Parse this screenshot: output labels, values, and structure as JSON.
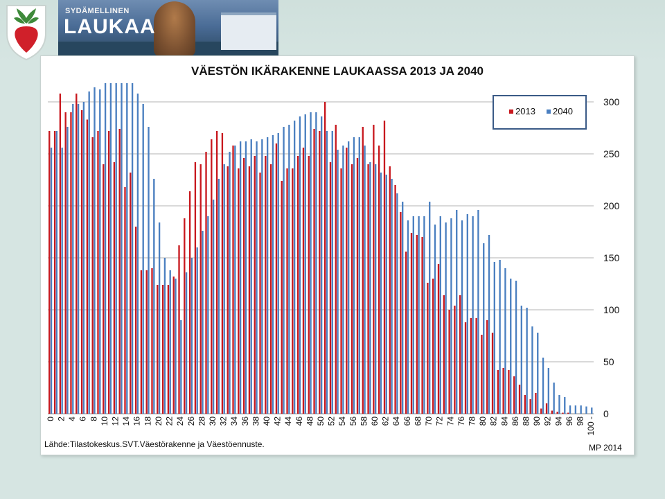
{
  "header": {
    "banner_small": "SYDÄMELLINEN",
    "banner_big": "LAUKAA"
  },
  "source": "Lähde:Tilastokeskus.SVT.Väestörakenne ja Väestöennuste.",
  "credit": "MP 2014",
  "colors": {
    "series_2013": "#c8181e",
    "series_2040": "#4a7fc0",
    "border": "#3a5a86",
    "gridline": "#b3b3b3"
  },
  "chart_data": {
    "type": "bar",
    "title": "VÄESTÖN IKÄRAKENNE LAUKAASSA 2013 JA 2040",
    "ylim": [
      0,
      320
    ],
    "yticks": [
      0,
      50,
      100,
      150,
      200,
      250,
      300
    ],
    "y_axis_side": "right",
    "grid": true,
    "legend_position": "top-right",
    "x_tick_labels": [
      "0",
      "2",
      "4",
      "6",
      "8",
      "10",
      "12",
      "14",
      "16",
      "18",
      "20",
      "22",
      "24",
      "26",
      "28",
      "30",
      "32",
      "34",
      "36",
      "38",
      "40",
      "42",
      "44",
      "46",
      "48",
      "50",
      "52",
      "54",
      "56",
      "58",
      "60",
      "62",
      "64",
      "66",
      "68",
      "70",
      "72",
      "74",
      "76",
      "78",
      "80",
      "82",
      "84",
      "86",
      "88",
      "90",
      "92",
      "94",
      "96",
      "98",
      "100 -"
    ],
    "categories": [
      "0",
      "1",
      "2",
      "3",
      "4",
      "5",
      "6",
      "7",
      "8",
      "9",
      "10",
      "11",
      "12",
      "13",
      "14",
      "15",
      "16",
      "17",
      "18",
      "19",
      "20",
      "21",
      "22",
      "23",
      "24",
      "25",
      "26",
      "27",
      "28",
      "29",
      "30",
      "31",
      "32",
      "33",
      "34",
      "35",
      "36",
      "37",
      "38",
      "39",
      "40",
      "41",
      "42",
      "43",
      "44",
      "45",
      "46",
      "47",
      "48",
      "49",
      "50",
      "51",
      "52",
      "53",
      "54",
      "55",
      "56",
      "57",
      "58",
      "59",
      "60",
      "61",
      "62",
      "63",
      "64",
      "65",
      "66",
      "67",
      "68",
      "69",
      "70",
      "71",
      "72",
      "73",
      "74",
      "75",
      "76",
      "77",
      "78",
      "79",
      "80",
      "81",
      "82",
      "83",
      "84",
      "85",
      "86",
      "87",
      "88",
      "89",
      "90",
      "91",
      "92",
      "93",
      "94",
      "95",
      "96",
      "97",
      "98",
      "99",
      "100 -"
    ],
    "series": [
      {
        "name": "2013",
        "values": [
          272,
          272,
          308,
          290,
          290,
          308,
          292,
          283,
          266,
          272,
          240,
          272,
          242,
          274,
          218,
          232,
          180,
          138,
          138,
          140,
          124,
          124,
          124,
          132,
          162,
          188,
          214,
          242,
          240,
          252,
          264,
          272,
          270,
          238,
          258,
          236,
          246,
          238,
          248,
          232,
          248,
          240,
          260,
          224,
          236,
          236,
          248,
          256,
          248,
          274,
          272,
          300,
          242,
          278,
          236,
          256,
          240,
          246,
          276,
          240,
          278,
          258,
          282,
          238,
          220,
          194,
          156,
          174,
          172,
          170,
          126,
          130,
          144,
          114,
          100,
          104,
          114,
          88,
          92,
          92,
          76,
          90,
          78,
          42,
          44,
          42,
          36,
          28,
          18,
          14,
          20,
          5,
          10,
          3,
          2,
          1,
          1
        ]
      },
      {
        "name": "2040",
        "values": [
          256,
          272,
          256,
          276,
          298,
          298,
          300,
          310,
          314,
          312,
          318,
          318,
          318,
          318,
          318,
          318,
          308,
          298,
          276,
          226,
          184,
          150,
          138,
          130,
          90,
          136,
          150,
          160,
          176,
          190,
          206,
          226,
          240,
          252,
          258,
          262,
          262,
          264,
          262,
          264,
          266,
          268,
          270,
          276,
          278,
          282,
          286,
          288,
          290,
          290,
          286,
          272,
          272,
          254,
          258,
          262,
          266,
          266,
          258,
          242,
          240,
          232,
          230,
          226,
          212,
          204,
          186,
          190,
          190,
          190,
          204,
          182,
          190,
          184,
          188,
          196,
          186,
          192,
          190,
          196,
          164,
          172,
          146,
          148,
          140,
          130,
          128,
          104,
          102,
          84,
          78,
          54,
          44,
          30,
          18,
          16,
          8,
          8,
          8,
          7,
          6
        ]
      }
    ]
  }
}
